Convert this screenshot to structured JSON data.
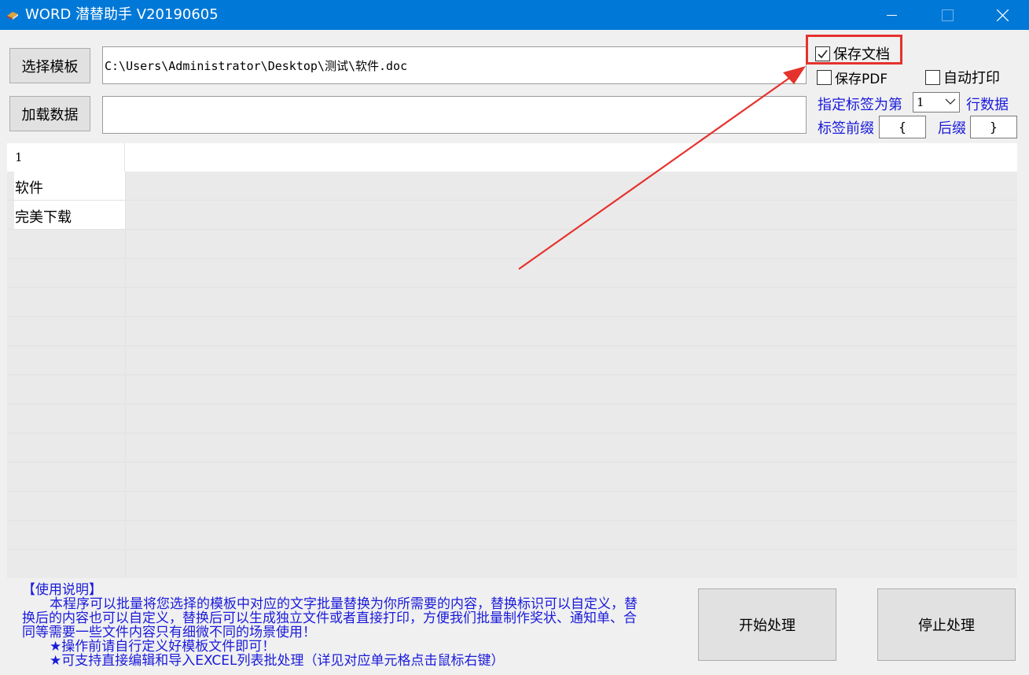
{
  "window": {
    "title": "WORD 潜替助手 V20190605",
    "icon": "app-logo-icon",
    "controls": [
      "minimize-icon",
      "maximize-icon",
      "close-icon"
    ]
  },
  "toolbar": {
    "select_template_label": "选择模板",
    "template_path": "C:\\Users\\Administrator\\Desktop\\测试\\软件.doc",
    "load_data_label": "加载数据",
    "data_path": ""
  },
  "options": {
    "save_doc": {
      "label": "保存文档",
      "checked": true
    },
    "save_pdf": {
      "label": "保存PDF",
      "checked": false
    },
    "auto_print": {
      "label": "自动打印",
      "checked": false
    },
    "label_row_prefix": "指定标签为第",
    "label_row_value": "1",
    "label_row_suffix": "行数据",
    "tag_prefix_label": "标签前缀",
    "tag_prefix_value": "{",
    "tag_suffix_label": "后缀",
    "tag_suffix_value": "}"
  },
  "grid": {
    "header": [
      "1"
    ],
    "rows": [
      [
        "软件"
      ],
      [
        "完美下载"
      ]
    ]
  },
  "info": {
    "heading": "【使用说明】",
    "lines": [
      "本程序可以批量将您选择的模板中对应的文字批量替换为你所需要的内容，替换标识可以自定义，替",
      "换后的内容也可以自定义，替换后可以生成独立文件或者直接打印，方便我们批量制作奖状、通知单、合",
      "同等需要一些文件内容只有细微不同的场景使用！",
      "★操作前请自行定义好模板文件即可！",
      "★可支持直接编辑和导入EXCEL列表批处理（详见对应单元格点击鼠标右键）"
    ]
  },
  "actions": {
    "start_label": "开始处理",
    "stop_label": "停止处理"
  },
  "colors": {
    "titlebar": "#0078d7",
    "highlight": "#e5322d",
    "info_text": "#1a1adb"
  }
}
